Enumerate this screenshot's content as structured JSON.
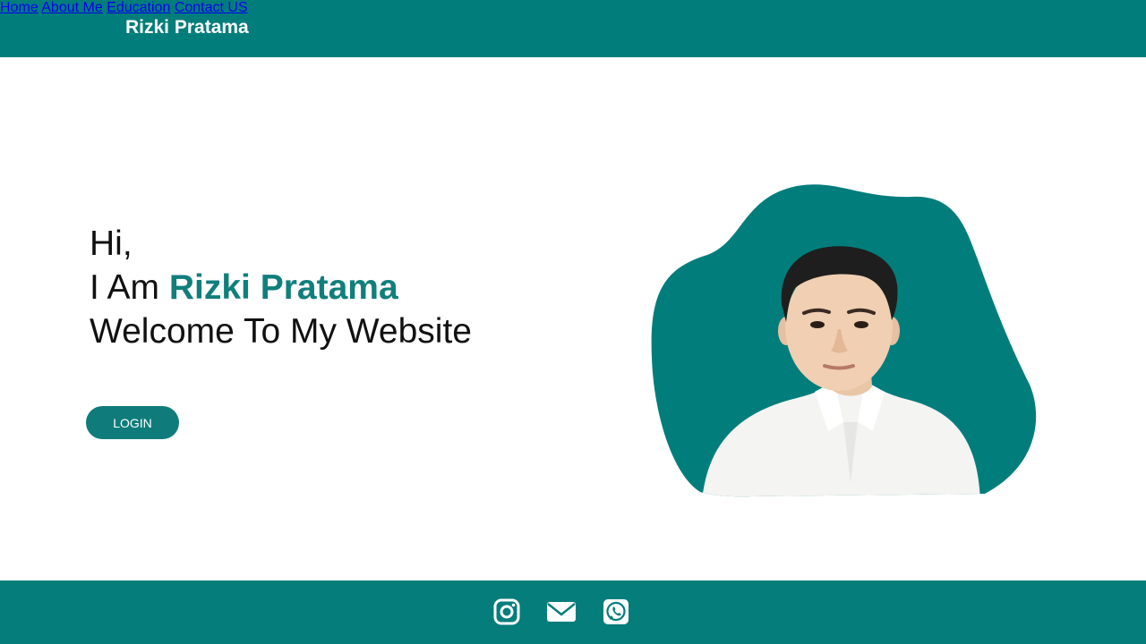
{
  "header": {
    "brand": "Rizki Pratama",
    "nav": [
      {
        "label": "Home"
      },
      {
        "label": "About Me"
      },
      {
        "label": "Education"
      },
      {
        "label": "Contact US"
      }
    ]
  },
  "hero": {
    "greeting": "Hi,",
    "intro_prefix": "I Am ",
    "name": "Rizki Pratama",
    "welcome": "Welcome To My Website",
    "login_label": "LOGIN"
  },
  "footer": {
    "icons": [
      "instagram-icon",
      "mail-icon",
      "whatsapp-icon"
    ]
  },
  "colors": {
    "primary": "#017d7c",
    "accent_text": "#107f7c",
    "text": "#111111",
    "background": "#ffffff"
  }
}
